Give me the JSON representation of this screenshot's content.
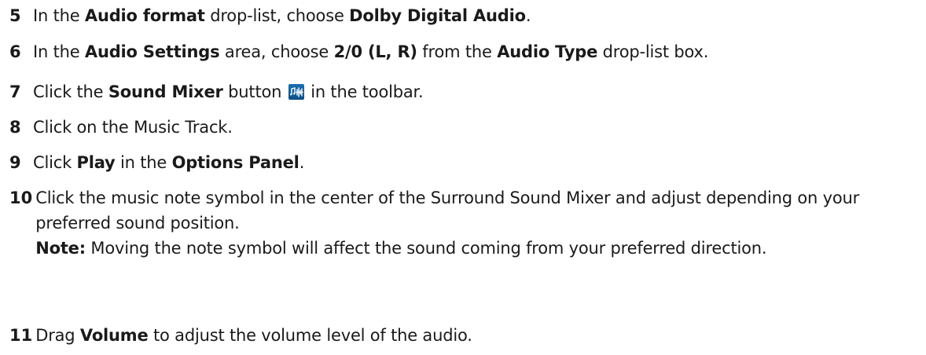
{
  "steps": [
    {
      "num": "5",
      "parts": [
        "In the ",
        "Audio format",
        " drop-list, choose ",
        "Dolby Digital Audio",
        "."
      ]
    },
    {
      "num": "6",
      "parts": [
        "In the ",
        "Audio Settings",
        " area, choose ",
        "2/0 (L, R)",
        " from the ",
        "Audio Type",
        " drop-list box."
      ]
    },
    {
      "num": "7",
      "parts": [
        "Click the ",
        "Sound Mixer",
        " button ",
        " in the toolbar."
      ],
      "icon": "sound-mixer-icon"
    },
    {
      "num": "8",
      "parts": [
        "Click on the Music Track."
      ]
    },
    {
      "num": "9",
      "parts": [
        "Click ",
        "Play",
        " in the ",
        "Options Panel",
        "."
      ]
    },
    {
      "num": "10",
      "line1": "Click the music note symbol in the center of the Surround Sound Mixer and adjust depending on your preferred sound position.",
      "note_label": "Note:",
      "note_text": " Moving the note symbol will affect the sound coming from your preferred direction."
    },
    {
      "num": "11",
      "parts": [
        "Drag ",
        "Volume",
        " to adjust the volume level of the audio."
      ]
    }
  ],
  "colors": {
    "text": "#1a1a1a",
    "icon_bg": "#1a6fb0"
  }
}
